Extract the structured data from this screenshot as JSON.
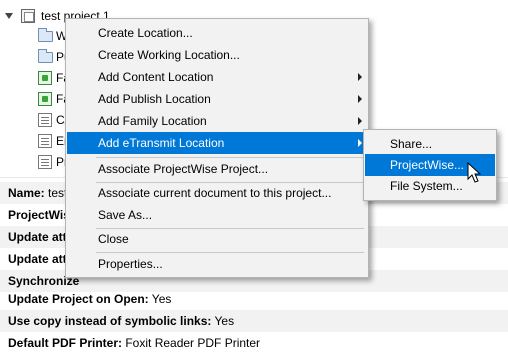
{
  "tree": {
    "project_label": "test project 1",
    "children": [
      {
        "label": "Wo",
        "icon": "folder-icon"
      },
      {
        "label": "Pu",
        "icon": "folder-icon"
      },
      {
        "label": "Fa",
        "icon": "family-icon"
      },
      {
        "label": "Fa",
        "icon": "family-icon"
      },
      {
        "label": "CA",
        "icon": "doc-icon"
      },
      {
        "label": "En",
        "icon": "doc-icon"
      },
      {
        "label": "Pro",
        "icon": "doc-icon"
      }
    ]
  },
  "properties": [
    {
      "key": "Name:",
      "value": " test"
    },
    {
      "key": "ProjectWise",
      "value": ""
    },
    {
      "key": "Update attr",
      "value": ""
    },
    {
      "key": "Update attr",
      "value": ""
    },
    {
      "key": "Synchronize",
      "value": ""
    },
    {
      "key": "Update Project on Open:",
      "value": " Yes"
    },
    {
      "key": "Use copy instead of symbolic links:",
      "value": " Yes"
    },
    {
      "key": "Default PDF Printer:",
      "value": " Foxit Reader PDF Printer"
    }
  ],
  "context_menu": {
    "items": [
      {
        "label": "Create Location...",
        "submenu": false
      },
      {
        "label": "Create Working Location...",
        "submenu": false
      },
      {
        "label": "Add Content Location",
        "submenu": true
      },
      {
        "label": "Add Publish Location",
        "submenu": true
      },
      {
        "label": "Add Family Location",
        "submenu": true
      },
      {
        "label": "Add eTransmit Location",
        "submenu": true
      },
      {
        "label": "Associate ProjectWise Project...",
        "submenu": false
      },
      {
        "label": "Associate current document to this project...",
        "submenu": false
      },
      {
        "label": "Save As...",
        "submenu": false
      },
      {
        "label": "Close",
        "submenu": false
      },
      {
        "label": "Properties...",
        "submenu": false
      }
    ]
  },
  "submenu": {
    "items": [
      {
        "label": "Share..."
      },
      {
        "label": "ProjectWise..."
      },
      {
        "label": "File System..."
      }
    ]
  },
  "colors": {
    "highlight": "#0078d7",
    "menu_bg": "#f2f2f2"
  }
}
